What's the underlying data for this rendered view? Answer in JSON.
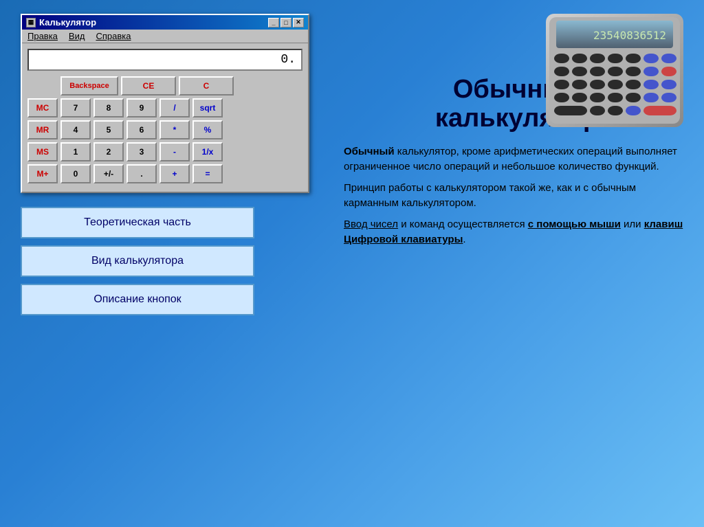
{
  "window": {
    "title": "Калькулятор",
    "minimize_label": "_",
    "maximize_label": "□",
    "close_label": "✕"
  },
  "menu": {
    "items": [
      "Правка",
      "Вид",
      "Справка"
    ]
  },
  "calculator": {
    "display_value": "0.",
    "buttons": {
      "row1": {
        "empty_label": "",
        "backspace_label": "Backspace",
        "ce_label": "CE",
        "c_label": "C"
      },
      "row2": {
        "mc": "MC",
        "n7": "7",
        "n8": "8",
        "n9": "9",
        "div": "/",
        "sqrt": "sqrt"
      },
      "row3": {
        "mr": "MR",
        "n4": "4",
        "n5": "5",
        "n6": "6",
        "mul": "*",
        "percent": "%"
      },
      "row4": {
        "ms": "MS",
        "n1": "1",
        "n2": "2",
        "n3": "3",
        "sub": "-",
        "inv": "1/x"
      },
      "row5": {
        "mplus": "M+",
        "n0": "0",
        "sign": "+/-",
        "dot": ".",
        "add": "+",
        "eq": "="
      }
    }
  },
  "nav_buttons": [
    "Теоретическая часть",
    "Вид калькулятора",
    "Описание кнопок"
  ],
  "right": {
    "title_line1": "Обычный",
    "title_line2": "калькулятор",
    "paragraphs": [
      {
        "bold_start": "Обычный",
        "rest": " калькулятор, кроме арифметических операций выполняет ограниченное число операций и небольшое количество функций."
      },
      {
        "text": "Принцип работы с калькулятором такой же, как и с обычным карманным калькулятором."
      },
      {
        "underline1": "Ввод чисел",
        "mid": " и команд осуществляется ",
        "underline2": "с помощью мыши",
        "mid2": " или ",
        "underline3": "клавиш Цифровой клавиатуры",
        "end": "."
      }
    ]
  }
}
